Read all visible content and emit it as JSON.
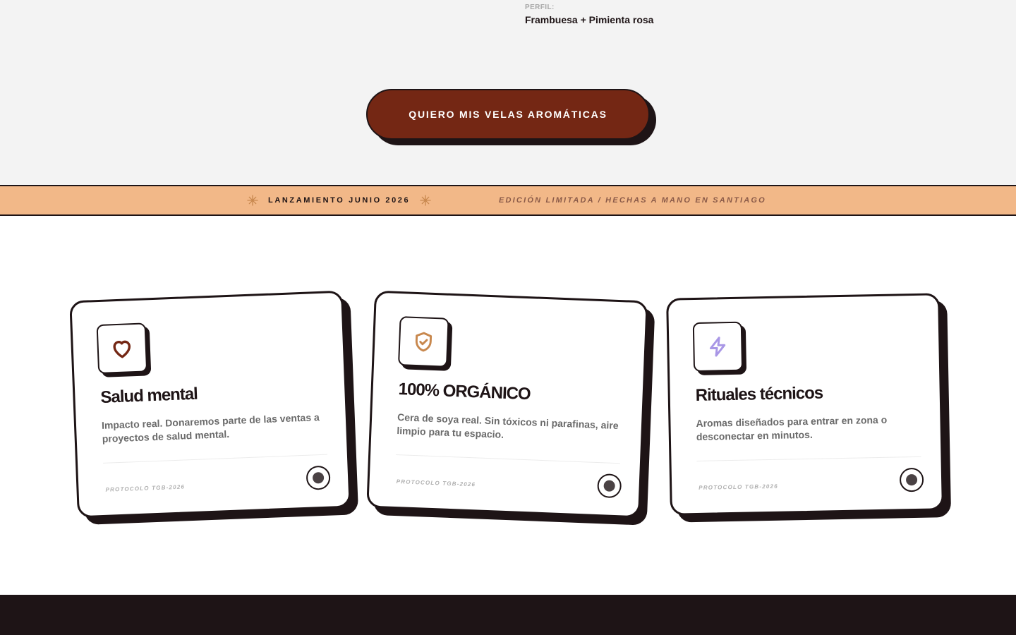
{
  "profile": {
    "label": "PERFIL:",
    "value": "Frambuesa + Pimienta rosa"
  },
  "cta": {
    "label": "QUIERO MIS VELAS AROMÁTICAS"
  },
  "ticker": {
    "main": "LANZAMIENTO JUNIO 2026",
    "secondary": "EDICIÓN LIMITADA / HECHAS A MANO EN SANTIAGO"
  },
  "cards": [
    {
      "icon": "heart-icon",
      "icon_color": "#742714",
      "title": "Salud mental",
      "description": "Impacto real. Donaremos parte de las ventas a proyectos de salud mental.",
      "footer": "PROTOCOLO TGB-2026"
    },
    {
      "icon": "shield-check-icon",
      "icon_color": "#c8884e",
      "title": "100% ORGÁNICO",
      "description": "Cera de soya real. Sin tóxicos ni parafinas, aire limpio para tu espacio.",
      "footer": "PROTOCOLO TGB-2026"
    },
    {
      "icon": "lightning-icon",
      "icon_color": "#a997e6",
      "title": "Rituales técnicos",
      "description": "Aromas diseñados para entrar en zona o desconectar en minutos.",
      "footer": "PROTOCOLO TGB-2026"
    }
  ],
  "colors": {
    "accent": "#742714",
    "ink": "#1e1416",
    "ticker_bg": "#f2b888",
    "top_bg": "#f3f3f3"
  }
}
